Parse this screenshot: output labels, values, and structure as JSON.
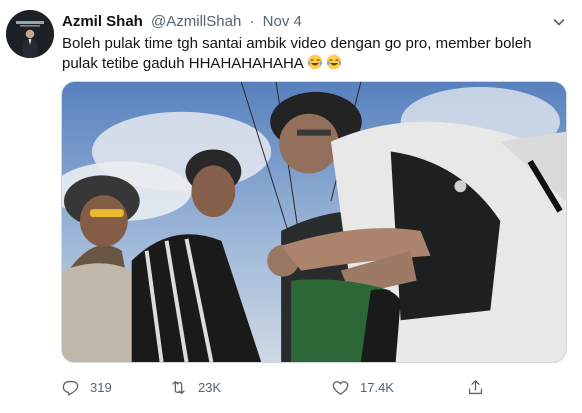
{
  "tweet": {
    "author": {
      "display_name": "Azmil Shah",
      "handle": "@AzmillShah",
      "avatar_icon": "profile-photo",
      "avatar_caption": "Azmil Shah"
    },
    "separator": "·",
    "date": "Nov 4",
    "text": "Boleh pulak time tgh santai ambik video dengan go pro, member boleh pulak tetibe gaduh HHAHAHAHAHA",
    "emojis": [
      "face-with-tears-of-joy",
      "face-with-tears-of-joy"
    ],
    "media": {
      "type": "video",
      "description_icon": "video-thumbnail"
    },
    "actions": {
      "reply": {
        "icon": "reply-icon",
        "count": "319"
      },
      "retweet": {
        "icon": "retweet-icon",
        "count": "23K"
      },
      "like": {
        "icon": "heart-icon",
        "count": "17.4K"
      },
      "share": {
        "icon": "share-icon"
      }
    }
  },
  "colors": {
    "text": "#0f1419",
    "secondary": "#536471",
    "border": "#cfd9de"
  }
}
